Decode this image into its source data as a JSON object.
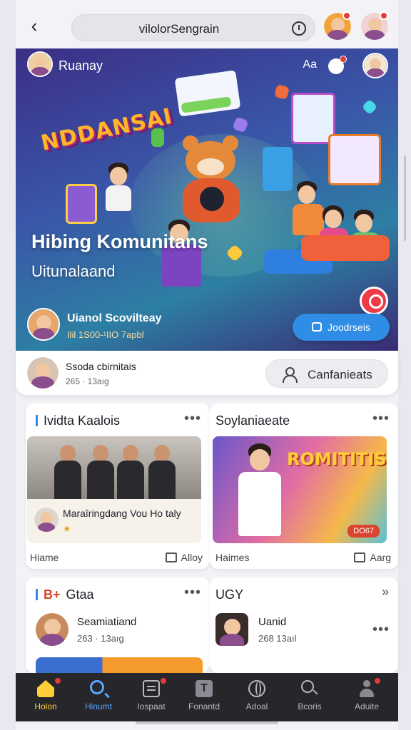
{
  "topbar": {
    "url": "vilolorSengrain"
  },
  "hero": {
    "username": "Ruanay",
    "az_label": "Aa",
    "logo_text": "NDDANSAI",
    "title": "Hibing Komunitans",
    "subtitle": "Uitunalaand",
    "host_name": "Uianol Scovilteay",
    "host_meta": "Ilil 1S00-¹IIO 7apbl",
    "cta_label": "Joodrseis"
  },
  "community": {
    "name": "Ssoda cbirnitais",
    "meta": "265 · 13aıg",
    "button_label": "Canfanieats"
  },
  "cards": [
    {
      "title": "Ividta Kaalois",
      "overlay_text": "Maraîringdang Vou Ho taly",
      "overlay_stars": "★",
      "foot_left": "Hiame",
      "foot_right": "Alloy"
    },
    {
      "title": "Soylaniaeate",
      "poster_title": "ROMITITIS",
      "poster_tag": "DO67",
      "foot_left": "Haimes",
      "foot_right": "Aarg"
    },
    {
      "title": "Gtaa",
      "prefix": "B+",
      "name": "Seamiatiand",
      "meta": "263 · 13aıg"
    },
    {
      "title": "UGY",
      "name": "Uanid",
      "meta": "268 13aıl"
    }
  ],
  "nav": [
    {
      "label": "Holon",
      "icon": "home-icon"
    },
    {
      "label": "Hinumt",
      "icon": "search-icon"
    },
    {
      "label": "Iospaat",
      "icon": "document-icon"
    },
    {
      "label": "Fonantd",
      "icon": "text-icon"
    },
    {
      "label": "Adoal",
      "icon": "globe-icon"
    },
    {
      "label": "Bcoris",
      "icon": "magnifier-icon"
    },
    {
      "label": "Aduite",
      "icon": "user-icon"
    }
  ],
  "colors": {
    "accent": "#2f8de6",
    "nav_bg": "#26262b",
    "badge": "#e23b3b"
  }
}
